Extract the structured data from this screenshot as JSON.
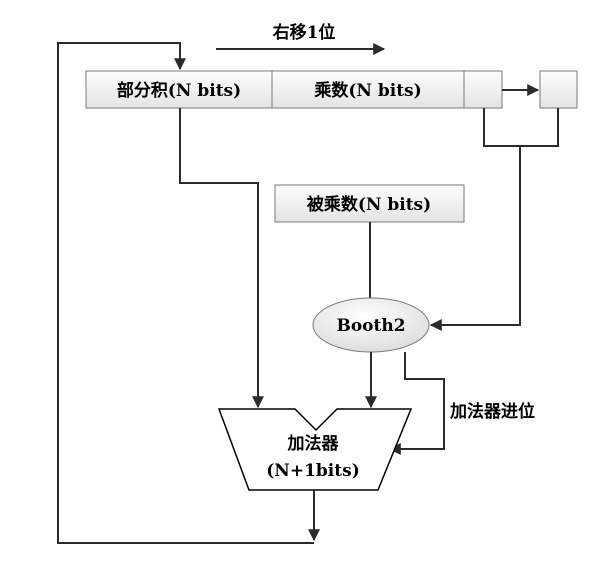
{
  "shift_label": "右移1位",
  "partial_product_label": "部分积(N bits)",
  "multiplier_label": "乘数(N bits)",
  "multiplicand_label": "被乘数(N bits)",
  "booth_label": "Booth2",
  "adder_label_line1": "加法器",
  "adder_label_line2": "(N+1bits)",
  "carry_label": "加法器进位"
}
